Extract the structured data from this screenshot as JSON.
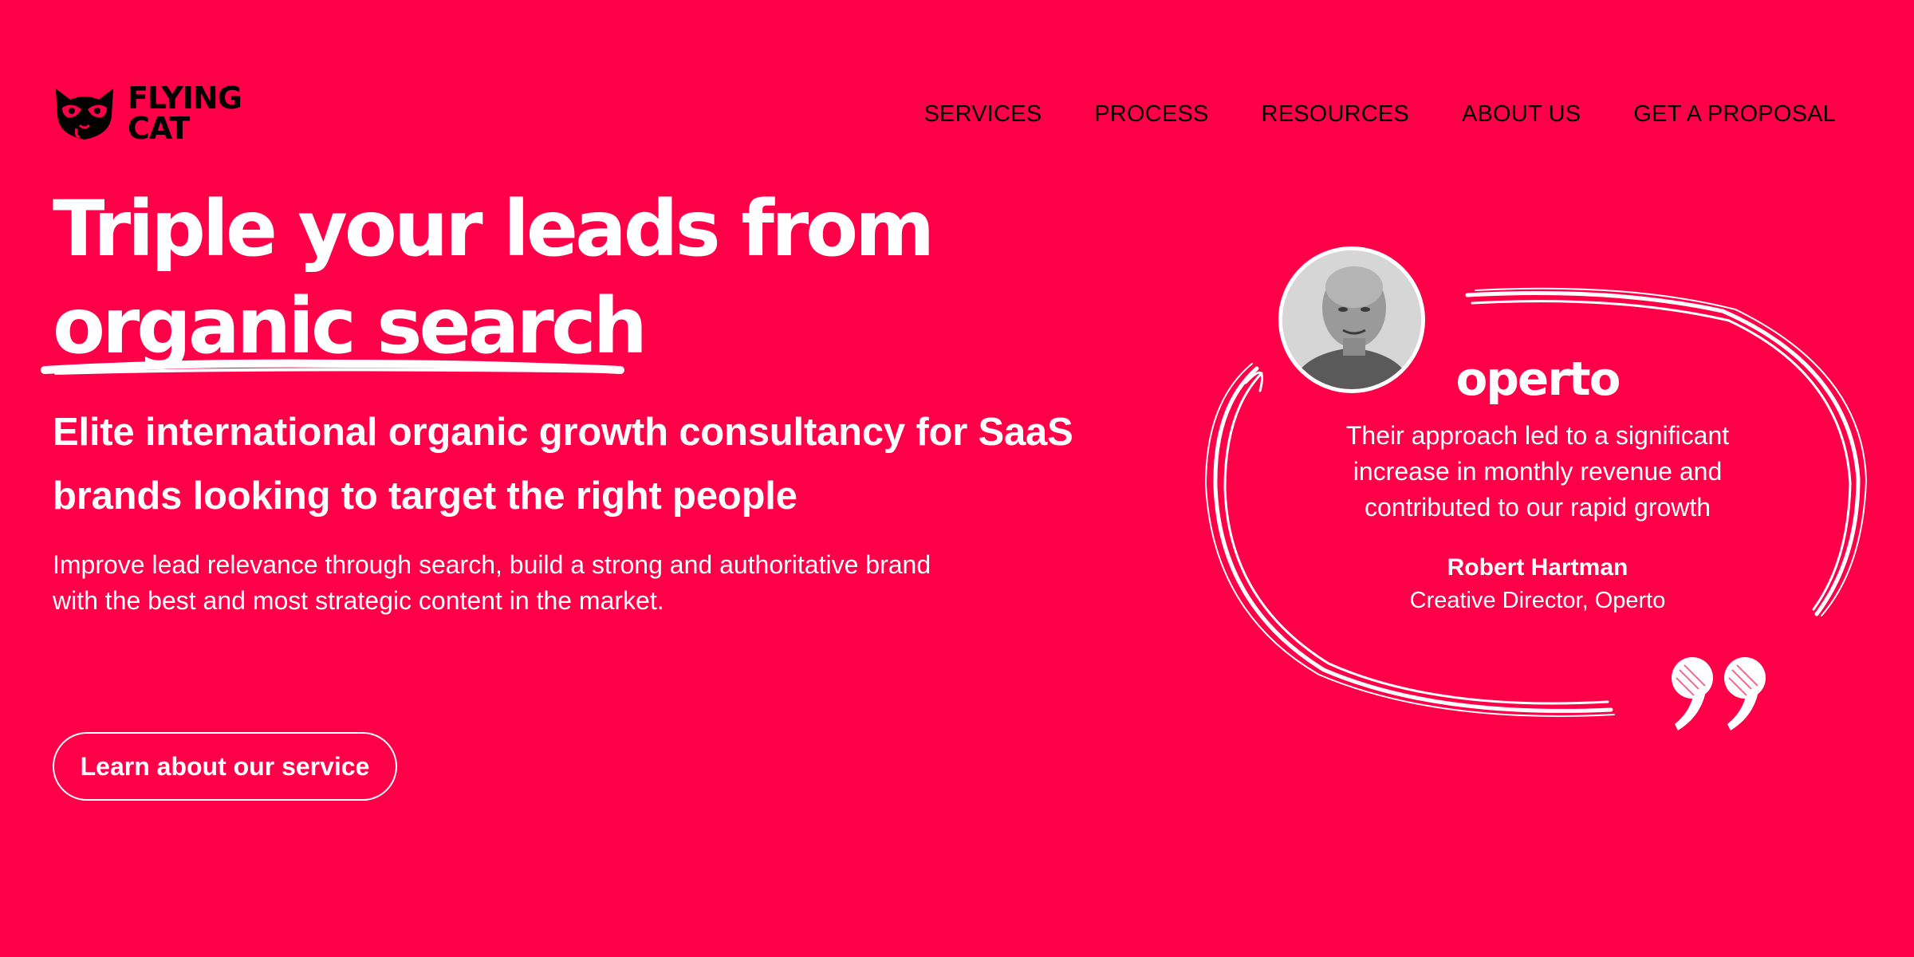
{
  "colors": {
    "background": "#ff0048",
    "foreground": "#ffffff",
    "nav_text": "#000000"
  },
  "header": {
    "logo": {
      "icon": "cat-head-icon",
      "line1": "FLYING",
      "line2": "CAT"
    },
    "nav": [
      {
        "label": "SERVICES"
      },
      {
        "label": "PROCESS"
      },
      {
        "label": "RESOURCES"
      },
      {
        "label": "ABOUT US"
      },
      {
        "label": "GET A PROPOSAL"
      }
    ]
  },
  "hero": {
    "headline_line1": "Triple your leads from",
    "headline_line2": "organic search",
    "subheadline_line1": "Elite international organic growth consultancy for SaaS",
    "subheadline_line2": "brands looking to target the right people",
    "description_line1": "Improve lead relevance through search, build a strong and authoritative brand",
    "description_line2": "with the best and most strategic content in the market.",
    "cta_label": "Learn about our service"
  },
  "testimonial": {
    "avatar_icon": "person-photo",
    "company": "operto",
    "quote_line1": "Their approach led to a significant",
    "quote_line2": "increase in monthly revenue and",
    "quote_line3": "contributed to our rapid growth",
    "author": "Robert Hartman",
    "role": "Creative Director, Operto",
    "decoration_icon": "quote-marks-icon"
  }
}
